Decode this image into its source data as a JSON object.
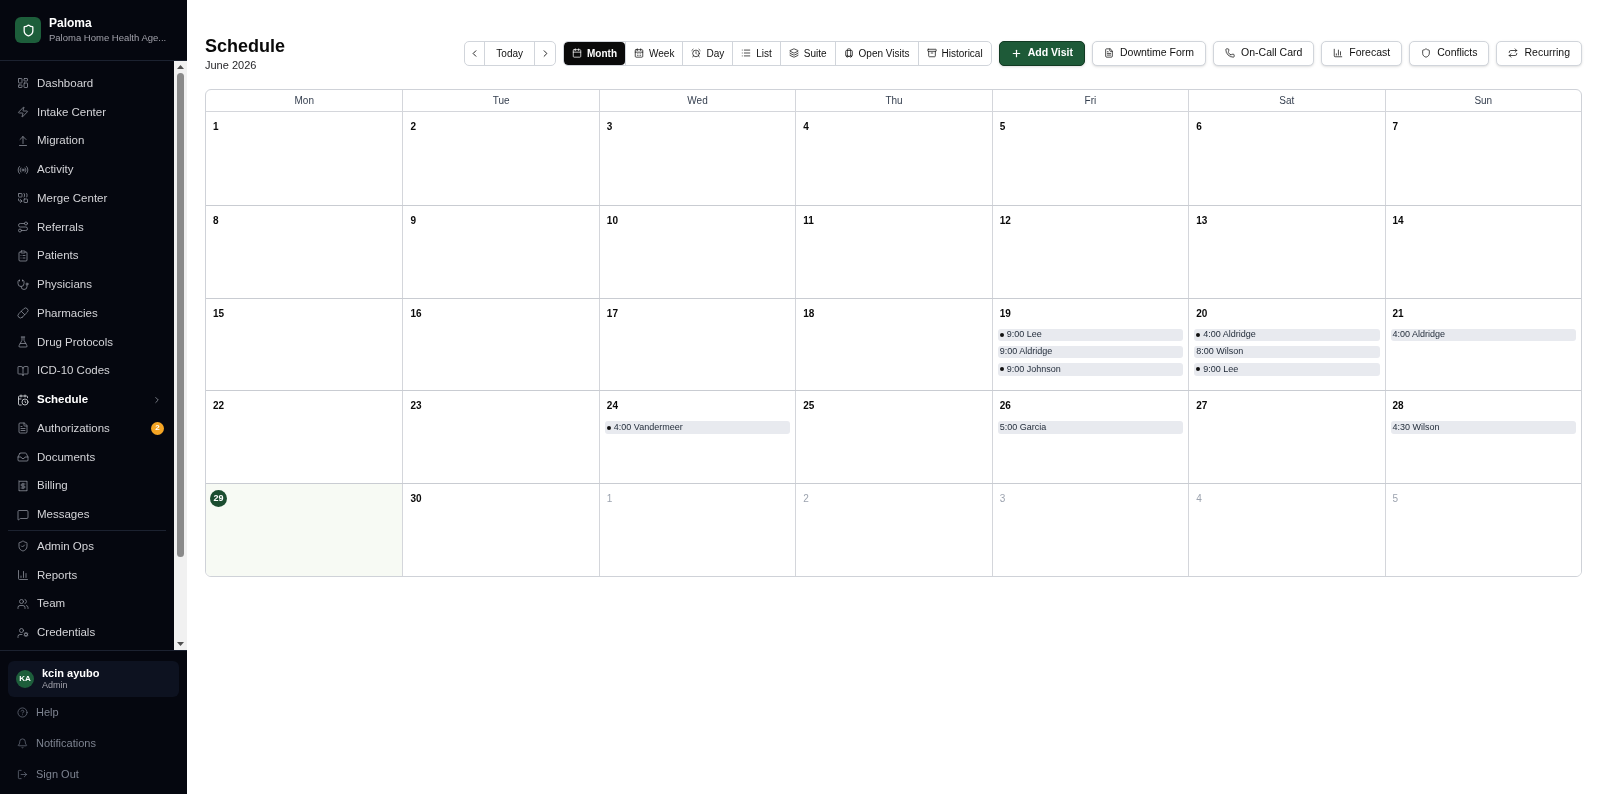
{
  "sidebar": {
    "brand": {
      "name": "Paloma",
      "subtitle": "Paloma Home Health Age..."
    },
    "nav_groups": [
      {
        "items": [
          {
            "label": "Dashboard",
            "selected": false
          },
          {
            "label": "Intake Center",
            "selected": false
          },
          {
            "label": "Migration",
            "selected": false
          },
          {
            "label": "Activity",
            "selected": false
          },
          {
            "label": "Merge Center",
            "selected": false
          },
          {
            "label": "Referrals",
            "selected": false
          },
          {
            "label": "Patients",
            "selected": false
          },
          {
            "label": "Physicians",
            "selected": false
          },
          {
            "label": "Pharmacies",
            "selected": false
          },
          {
            "label": "Drug Protocols",
            "selected": false
          },
          {
            "label": "ICD-10 Codes",
            "selected": false
          },
          {
            "label": "Schedule",
            "selected": true
          },
          {
            "label": "Authorizations",
            "selected": false,
            "badge": "2"
          },
          {
            "label": "Documents",
            "selected": false
          },
          {
            "label": "Billing",
            "selected": false
          },
          {
            "label": "Messages",
            "selected": false
          }
        ]
      },
      {
        "items": [
          {
            "label": "Admin Ops",
            "selected": false
          },
          {
            "label": "Reports",
            "selected": false
          },
          {
            "label": "Team",
            "selected": false
          },
          {
            "label": "Credentials",
            "selected": false
          }
        ]
      }
    ],
    "user": {
      "initials": "KA",
      "name": "kcin ayubo",
      "role": "Admin"
    },
    "footer_links": [
      "Help",
      "Notifications",
      "Sign Out"
    ]
  },
  "header": {
    "title": "Schedule",
    "subtitle": "June 2026"
  },
  "toolbar": {
    "today": "Today",
    "views": [
      {
        "label": "Month",
        "selected": true
      },
      {
        "label": "Week",
        "selected": false
      },
      {
        "label": "Day",
        "selected": false
      },
      {
        "label": "List",
        "selected": false
      },
      {
        "label": "Suite",
        "selected": false
      },
      {
        "label": "Open Visits",
        "selected": false
      },
      {
        "label": "Historical",
        "selected": false
      }
    ],
    "actions": [
      {
        "label": "Add Visit",
        "kind": "primary"
      },
      {
        "label": "Downtime Form",
        "kind": "outline"
      },
      {
        "label": "On-Call Card",
        "kind": "outline"
      },
      {
        "label": "Forecast",
        "kind": "outline"
      },
      {
        "label": "Conflicts",
        "kind": "outline"
      },
      {
        "label": "Recurring",
        "kind": "outline"
      }
    ]
  },
  "calendar": {
    "weekdays": [
      "Mon",
      "Tue",
      "Wed",
      "Thu",
      "Fri",
      "Sat",
      "Sun"
    ],
    "weeks": [
      {
        "days": [
          {
            "day": "1",
            "outside_month": false,
            "today": false
          },
          {
            "day": "2",
            "outside_month": false,
            "today": false
          },
          {
            "day": "3",
            "outside_month": false,
            "today": false
          },
          {
            "day": "4",
            "outside_month": false,
            "today": false
          },
          {
            "day": "5",
            "outside_month": false,
            "today": false
          },
          {
            "day": "6",
            "outside_month": false,
            "today": false
          },
          {
            "day": "7",
            "outside_month": false,
            "today": false
          }
        ]
      },
      {
        "days": [
          {
            "day": "8",
            "outside_month": false,
            "today": false
          },
          {
            "day": "9",
            "outside_month": false,
            "today": false
          },
          {
            "day": "10",
            "outside_month": false,
            "today": false
          },
          {
            "day": "11",
            "outside_month": false,
            "today": false
          },
          {
            "day": "12",
            "outside_month": false,
            "today": false
          },
          {
            "day": "13",
            "outside_month": false,
            "today": false
          },
          {
            "day": "14",
            "outside_month": false,
            "today": false
          }
        ]
      },
      {
        "days": [
          {
            "day": "15",
            "outside_month": false,
            "today": false
          },
          {
            "day": "16",
            "outside_month": false,
            "today": false
          },
          {
            "day": "17",
            "outside_month": false,
            "today": false
          },
          {
            "day": "18",
            "outside_month": false,
            "today": false
          },
          {
            "day": "19",
            "outside_month": false,
            "today": false,
            "events": [
              {
                "label": "9:00 Lee",
                "bullet": true
              },
              {
                "label": "9:00 Aldridge",
                "bullet": false
              },
              {
                "label": "9:00 Johnson",
                "bullet": true
              }
            ]
          },
          {
            "day": "20",
            "outside_month": false,
            "today": false,
            "events": [
              {
                "label": "4:00 Aldridge",
                "bullet": true
              },
              {
                "label": "8:00 Wilson",
                "bullet": false
              },
              {
                "label": "9:00 Lee",
                "bullet": true
              }
            ]
          },
          {
            "day": "21",
            "outside_month": false,
            "today": false,
            "events": [
              {
                "label": "4:00 Aldridge",
                "bullet": false
              }
            ]
          }
        ]
      },
      {
        "days": [
          {
            "day": "22",
            "outside_month": false,
            "today": false
          },
          {
            "day": "23",
            "outside_month": false,
            "today": false
          },
          {
            "day": "24",
            "outside_month": false,
            "today": false,
            "events": [
              {
                "label": "4:00 Vandermeer",
                "bullet": true
              }
            ]
          },
          {
            "day": "25",
            "outside_month": false,
            "today": false
          },
          {
            "day": "26",
            "outside_month": false,
            "today": false,
            "events": [
              {
                "label": "5:00 Garcia",
                "bullet": false
              }
            ]
          },
          {
            "day": "27",
            "outside_month": false,
            "today": false
          },
          {
            "day": "28",
            "outside_month": false,
            "today": false,
            "events": [
              {
                "label": "4:30 Wilson",
                "bullet": false
              }
            ]
          }
        ]
      },
      {
        "days": [
          {
            "day": "29",
            "outside_month": false,
            "today": true
          },
          {
            "day": "30",
            "outside_month": false,
            "today": false
          },
          {
            "day": "1",
            "outside_month": true,
            "today": false
          },
          {
            "day": "2",
            "outside_month": true,
            "today": false
          },
          {
            "day": "3",
            "outside_month": true,
            "today": false
          },
          {
            "day": "4",
            "outside_month": true,
            "today": false
          },
          {
            "day": "5",
            "outside_month": true,
            "today": false
          }
        ]
      }
    ]
  }
}
